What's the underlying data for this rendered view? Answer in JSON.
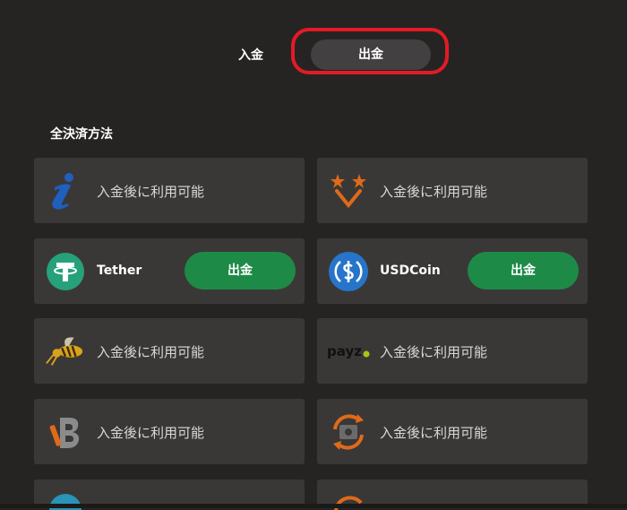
{
  "tabs": {
    "deposit_label": "入金",
    "withdraw_label": "出金"
  },
  "section": {
    "title": "全決済方法"
  },
  "methods": [
    {
      "status": "入金後に利用可能",
      "icon": "info-i-icon"
    },
    {
      "status": "入金後に利用可能",
      "icon": "stars-check-icon"
    },
    {
      "name": "Tether",
      "button": "出金",
      "icon": "tether-icon"
    },
    {
      "name": "USDCoin",
      "button": "出金",
      "icon": "usdc-icon"
    },
    {
      "status": "入金後に利用可能",
      "icon": "hornet-icon"
    },
    {
      "status": "入金後に利用可能",
      "icon": "payz-logo",
      "logo_text": "payz"
    },
    {
      "status": "入金後に利用可能",
      "icon": "b-logo-icon"
    },
    {
      "status": "入金後に利用可能",
      "icon": "exchange-arrows-icon"
    }
  ],
  "colors": {
    "background": "#262423",
    "card": "#3a3837",
    "button": "#1e8a47",
    "highlight": "#e31b24",
    "tether": "#26a17b",
    "usdc": "#2775ca"
  }
}
